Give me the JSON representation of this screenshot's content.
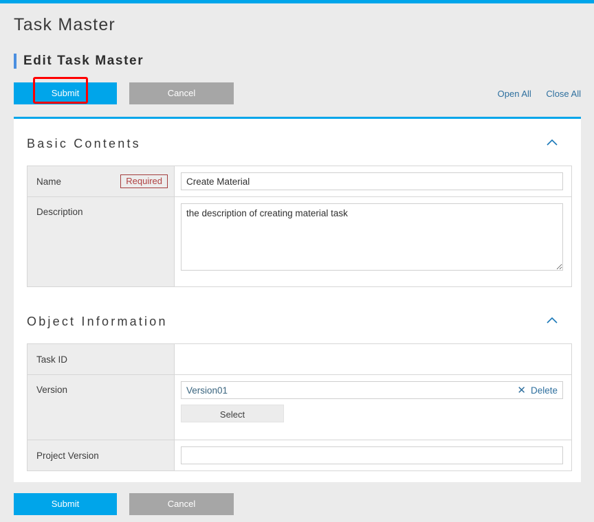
{
  "app": {
    "title": "Task Master",
    "subtitle": "Edit Task Master"
  },
  "toolbar": {
    "submit_label": "Submit",
    "cancel_label": "Cancel",
    "open_all_label": "Open All",
    "close_all_label": "Close All"
  },
  "footer": {
    "submit_label": "Submit",
    "cancel_label": "Cancel"
  },
  "groups": {
    "basic": {
      "title": "Basic Contents",
      "rows": {
        "name": {
          "label": "Name",
          "required_badge": "Required",
          "value": "Create Material"
        },
        "description": {
          "label": "Description",
          "value": "the description of creating material task"
        }
      }
    },
    "object": {
      "title": "Object Information",
      "rows": {
        "task_id": {
          "label": "Task ID",
          "value": ""
        },
        "version": {
          "label": "Version",
          "value": "Version01",
          "delete_label": "Delete",
          "select_label": "Select"
        },
        "project_version": {
          "label": "Project Version",
          "value": ""
        }
      }
    }
  },
  "colors": {
    "accent": "#00a5ea",
    "heading_accent": "#4a8fe0",
    "link": "#2e6f9e",
    "required": "#b04141",
    "annotation": "#ff0000",
    "secondary_button": "#a6a6a6"
  }
}
